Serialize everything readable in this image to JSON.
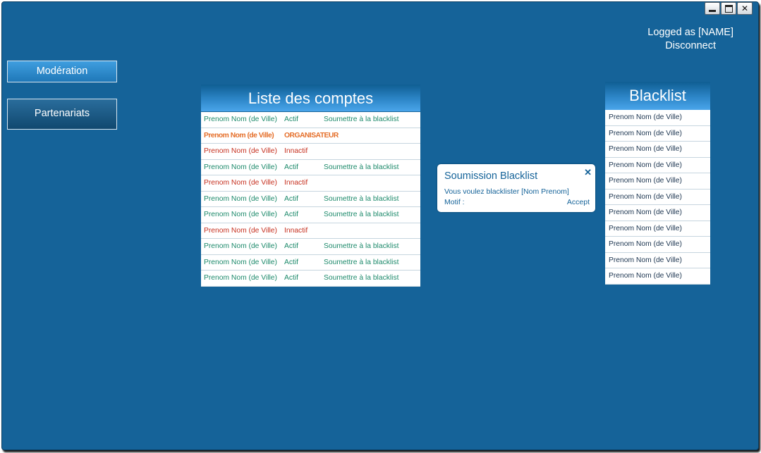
{
  "window": {
    "controls": {
      "minimize_icon": "minimize-icon",
      "maximize_icon": "maximize-icon",
      "close_icon": "close-icon",
      "close_glyph": "✕"
    }
  },
  "user": {
    "logged_as": "Logged as [NAME]",
    "disconnect": "Disconnect"
  },
  "nav": {
    "moderation": "Modération",
    "partnerships": "Partenariats"
  },
  "accounts": {
    "title": "Liste des comptes",
    "rows": [
      {
        "name": "Prenom Nom (de Ville)",
        "status": "Actif",
        "action": "Soumettre à la blacklist",
        "tone": "green"
      },
      {
        "name": "Prenom Nom (de Ville)",
        "status": "ORGANISATEUR",
        "action": "",
        "tone": "orange"
      },
      {
        "name": "Prenom Nom (de Ville)",
        "status": "Innactif",
        "action": "",
        "tone": "red"
      },
      {
        "name": "Prenom Nom (de Ville)",
        "status": "Actif",
        "action": "Soumettre à la blacklist",
        "tone": "green"
      },
      {
        "name": "Prenom Nom (de Ville)",
        "status": "Innactif",
        "action": "",
        "tone": "red"
      },
      {
        "name": "Prenom Nom (de Ville)",
        "status": "Actif",
        "action": "Soumettre à la blacklist",
        "tone": "green"
      },
      {
        "name": "Prenom Nom (de Ville)",
        "status": "Actif",
        "action": "Soumettre à la blacklist",
        "tone": "green"
      },
      {
        "name": "Prenom Nom (de Ville)",
        "status": "Innactif",
        "action": "",
        "tone": "red"
      },
      {
        "name": "Prenom Nom (de Ville)",
        "status": "Actif",
        "action": "Soumettre à la blacklist",
        "tone": "green"
      },
      {
        "name": "Prenom Nom (de Ville)",
        "status": "Actif",
        "action": "Soumettre à la blacklist",
        "tone": "green"
      },
      {
        "name": "Prenom Nom (de Ville)",
        "status": "Actif",
        "action": "Soumettre à la blacklist",
        "tone": "green"
      }
    ]
  },
  "blacklist": {
    "title": "Blacklist",
    "rows": [
      "Prenom Nom (de Ville)",
      "Prenom Nom (de Ville)",
      "Prenom Nom (de Ville)",
      "Prenom Nom (de Ville)",
      "Prenom Nom (de Ville)",
      "Prenom Nom (de Ville)",
      "Prenom Nom (de Ville)",
      "Prenom Nom (de Ville)",
      "Prenom Nom (de Ville)",
      "Prenom Nom (de Ville)",
      "Prenom Nom (de Ville)"
    ]
  },
  "popup": {
    "title": "Soumission Blacklist",
    "close_glyph": "✕",
    "message": "Vous voulez blacklister [Nom Prenom]",
    "motif_label": "Motif :",
    "accept": "Accept"
  },
  "colors": {
    "background": "#156399",
    "active": "#1d8a6b",
    "inactive": "#c6301f",
    "organizer": "#e56f2a"
  }
}
